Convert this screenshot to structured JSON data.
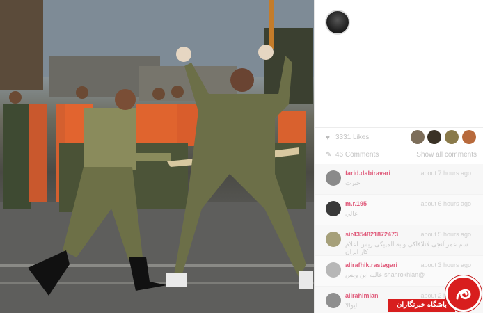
{
  "post": {
    "likes_text": "3331 Likes",
    "comments_text": "46 Comments",
    "show_all_label": "Show all comments"
  },
  "comments": [
    {
      "user": "farid.dabiravari",
      "time": "about 7 hours ago",
      "text": "خيرت",
      "avatar_color": "#8a8a8a"
    },
    {
      "user": "m.r.195",
      "time": "about 6 hours ago",
      "text": "عالي",
      "avatar_color": "#3a3a3a"
    },
    {
      "user": "sir4354821872473",
      "time": "about 5 hours ago",
      "text": "سم عمر آنجی لانلافاکی و به المپیکی ریس اعلام کار ایران",
      "avatar_color": "#a6a07a"
    },
    {
      "user": "alirafhik.rastegari",
      "time": "about 3 hours ago",
      "text": "@shahrokhian عالیه این ویس",
      "avatar_color": "#b7b7b7"
    },
    {
      "user": "alirahimian",
      "time": "about 2 hours ago",
      "text": "ایوالا",
      "avatar_color": "#8f8f8f"
    }
  ],
  "watermark": {
    "label": "باشگاه خبرنگاران",
    "color": "#d81e1e"
  }
}
